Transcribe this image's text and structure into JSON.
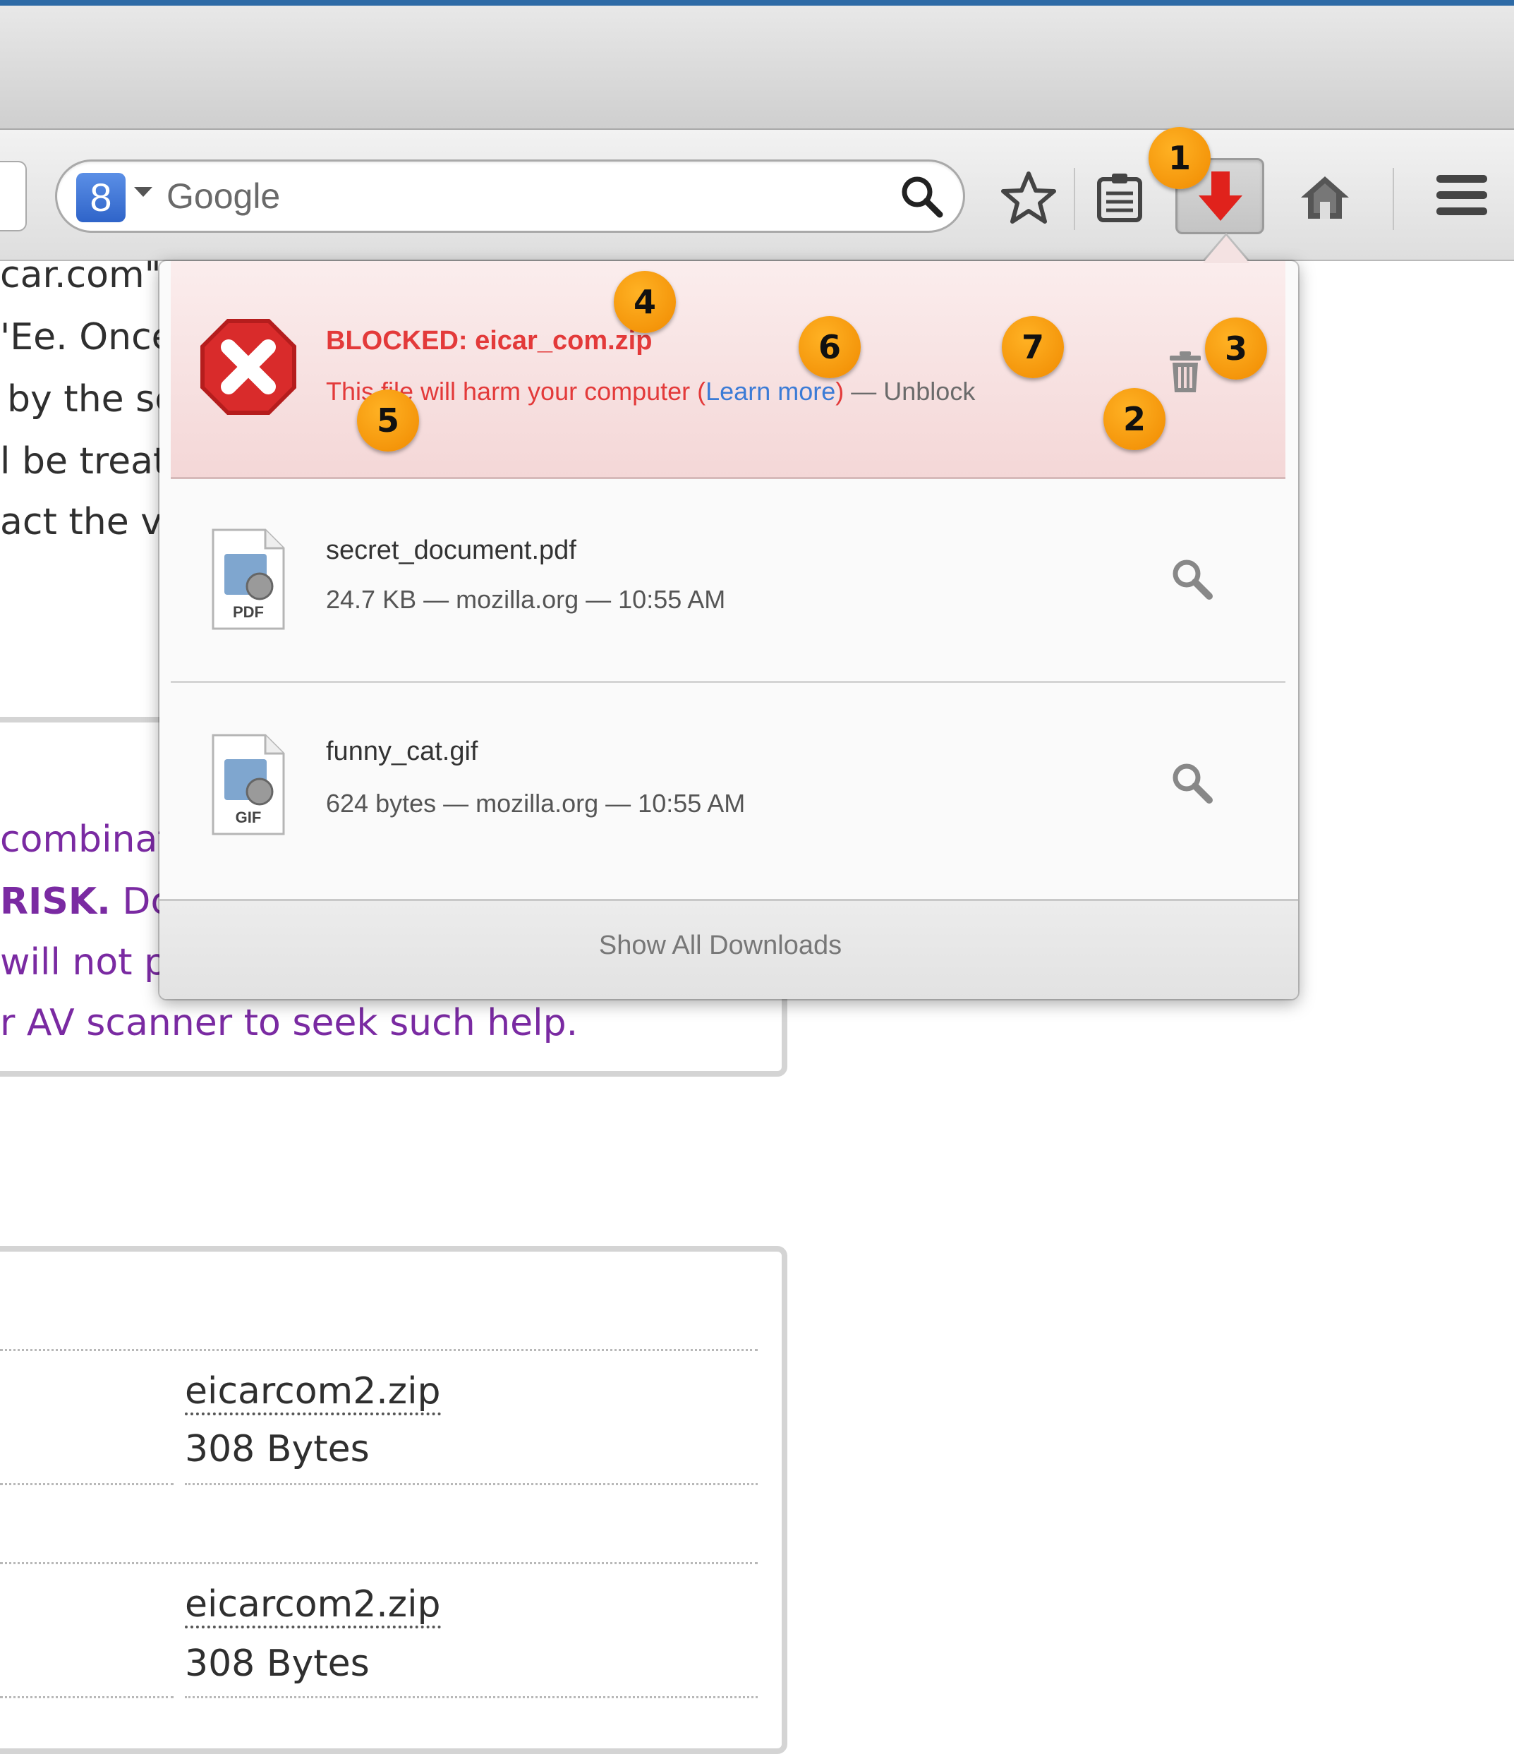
{
  "search": {
    "engine_icon_label": "8",
    "placeholder": "Google"
  },
  "icons": {
    "search": "magnifier-icon",
    "bookmark": "star-icon",
    "reading_list": "clipboard-icon",
    "downloads": "download-arrow-icon",
    "home": "home-icon",
    "menu": "hamburger-menu-icon"
  },
  "colors": {
    "blocked_text": "#e33a3a",
    "blocked_background": "#f6e1e1",
    "link": "#3b7bd6",
    "callout": "#f59a00",
    "page_purple": "#7a2aa2"
  },
  "page_behind": {
    "line1": "car.com\".",
    "line2": "'Ee. Once",
    "line3": "by the sc",
    "line4": "l be treat",
    "line5": "act the vi",
    "purple1": "combinat",
    "purple2_bold": "RISK.",
    "purple2_rest": "Dc",
    "purple3": "will not p",
    "purple4": "r AV scanner to seek such help.",
    "file_rows": [
      {
        "name": "eicarcom2.zip",
        "size": "308 Bytes"
      },
      {
        "name": "eicarcom2.zip",
        "size": "308 Bytes"
      }
    ]
  },
  "downloads_panel": {
    "blocked_item": {
      "name": "BLOCKED: eicar_com.zip",
      "warning": "This file will harm your computer (",
      "learn_more": "Learn more",
      "warning_close": ")",
      "separator": " — ",
      "unblock": "Unblock"
    },
    "items": [
      {
        "name": "secret_document.pdf",
        "status": "24.7 KB — mozilla.org — 10:55 AM",
        "type_label": "PDF"
      },
      {
        "name": "funny_cat.gif",
        "status": "624 bytes — mozilla.org — 10:55 AM",
        "type_label": "GIF"
      }
    ],
    "show_all": "Show All Downloads"
  },
  "callouts": [
    "1",
    "2",
    "3",
    "4",
    "5",
    "6",
    "7"
  ]
}
